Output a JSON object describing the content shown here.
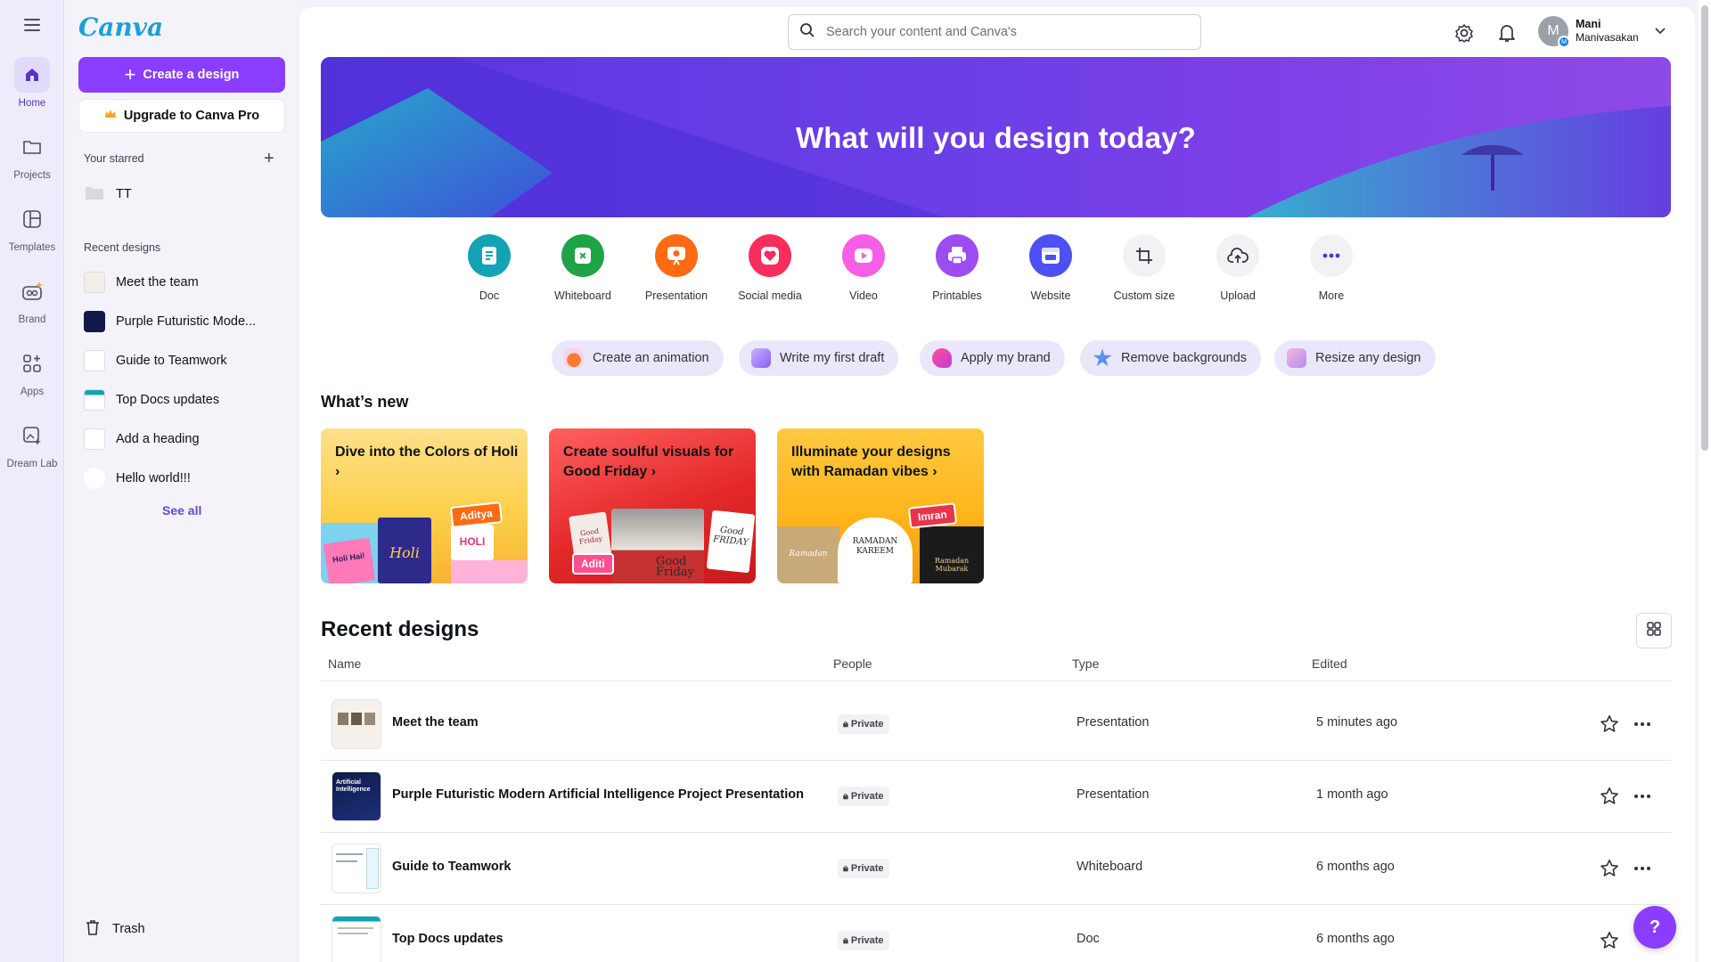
{
  "app": {
    "logo": "Canva"
  },
  "rail": {
    "items": [
      {
        "label": "Home",
        "icon": "home-icon"
      },
      {
        "label": "Projects",
        "icon": "folder-icon"
      },
      {
        "label": "Templates",
        "icon": "templates-icon"
      },
      {
        "label": "Brand",
        "icon": "brand-icon"
      },
      {
        "label": "Apps",
        "icon": "apps-icon"
      },
      {
        "label": "Dream Lab",
        "icon": "dream-lab-icon"
      }
    ]
  },
  "panel": {
    "create_label": "Create a design",
    "upgrade_label": "Upgrade to Canva Pro",
    "starred_title": "Your starred",
    "starred": [
      {
        "label": "TT",
        "icon": "folder-icon"
      }
    ],
    "recent_title": "Recent designs",
    "recent": [
      {
        "label": "Meet the team"
      },
      {
        "label": "Purple Futuristic Mode..."
      },
      {
        "label": "Guide to Teamwork"
      },
      {
        "label": "Top Docs updates"
      },
      {
        "label": "Add a heading"
      },
      {
        "label": "Hello world!!!"
      }
    ],
    "see_all": "See all",
    "trash": "Trash"
  },
  "header": {
    "search_placeholder": "Search your content and Canva's",
    "user_name": "Mani",
    "user_surname": "Manivasakan",
    "avatar_initial": "M",
    "avatar_badge": "M"
  },
  "hero": {
    "title": "What will you design today?"
  },
  "quick_actions": [
    {
      "label": "Doc",
      "color": "#13a3b5"
    },
    {
      "label": "Whiteboard",
      "color": "#1ea446"
    },
    {
      "label": "Presentation",
      "color": "#ff6a13"
    },
    {
      "label": "Social media",
      "color": "#fb2d5c"
    },
    {
      "label": "Video",
      "color": "#f55fe6"
    },
    {
      "label": "Printables",
      "color": "#9c4cf0"
    },
    {
      "label": "Website",
      "color": "#4d50f2"
    },
    {
      "label": "Custom size",
      "color": "#f1f2f4"
    },
    {
      "label": "Upload",
      "color": "#f1f2f4"
    },
    {
      "label": "More",
      "color": "#f1f2f4"
    }
  ],
  "chips": [
    {
      "label": "Create an animation"
    },
    {
      "label": "Write my first draft"
    },
    {
      "label": "Apply my brand"
    },
    {
      "label": "Remove backgrounds"
    },
    {
      "label": "Resize any design"
    }
  ],
  "whats_new": {
    "title": "What’s new",
    "cards": [
      {
        "title": "Dive into the Colors of Holi",
        "chevron": "›",
        "tag": "Aditya",
        "art": [
          "Holi Hai!",
          "Holi",
          "HOLI"
        ]
      },
      {
        "title": "Create soulful visuals for Good Friday",
        "chevron": "›",
        "tag": "Aditi",
        "art": [
          "Good Friday",
          "Good Friday",
          "Good FRIDAY"
        ]
      },
      {
        "title": "Illuminate your designs with Ramadan vibes",
        "chevron": "›",
        "tag": "Imran",
        "art": [
          "Ramadan",
          "RAMADAN KAREEM",
          "Ramadan Mubarak"
        ]
      }
    ]
  },
  "recent_designs": {
    "title": "Recent designs",
    "columns": [
      "Name",
      "People",
      "Type",
      "Edited"
    ],
    "rows": [
      {
        "name": "Meet the team",
        "people": "Private",
        "type": "Presentation",
        "edited": "5 minutes ago"
      },
      {
        "name": "Purple Futuristic Modern Artificial Intelligence Project Presentation",
        "people": "Private",
        "type": "Presentation",
        "edited": "1 month ago",
        "thumb_text": "Artificial Intelligence"
      },
      {
        "name": "Guide to Teamwork",
        "people": "Private",
        "type": "Whiteboard",
        "edited": "6 months ago"
      },
      {
        "name": "Top Docs updates",
        "people": "Private",
        "type": "Doc",
        "edited": "6 months ago"
      }
    ]
  },
  "help": {
    "label": "?"
  }
}
